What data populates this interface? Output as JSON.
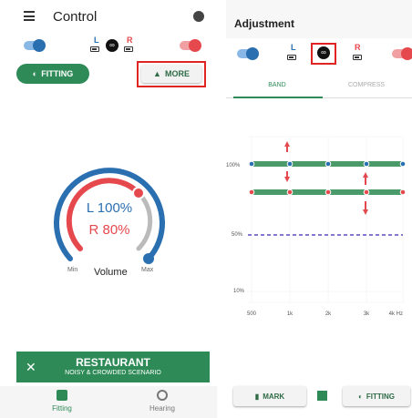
{
  "left": {
    "title": "Control",
    "left_label": "L",
    "right_label": "R",
    "fitting_label": "FITTING",
    "more_label": "MORE",
    "volume": {
      "left": "L 100%",
      "right": "R 80%",
      "label": "Volume",
      "min": "Min",
      "max": "Max",
      "left_level": 1.0,
      "right_level": 0.8
    },
    "scenario": {
      "title": "RESTAURANT",
      "subtitle": "NOISY & CROWDED SCENARIO"
    },
    "nav": [
      {
        "label": "Fitting",
        "icon": "fitting-icon"
      },
      {
        "label": "Hearing",
        "icon": "hearing-icon"
      }
    ]
  },
  "right": {
    "title": "Adjustment",
    "left_label": "L",
    "right_label": "R",
    "tabs": [
      "BAND",
      "COMPRESS"
    ],
    "chart_data": {
      "type": "line",
      "x": [
        "500",
        "1k",
        "2k",
        "3k",
        "4k Hz"
      ],
      "yticks": [
        "100%",
        "50%",
        "10%"
      ],
      "series": [
        {
          "color": "#2a6fb0",
          "level": 100
        },
        {
          "color": "#e5484d",
          "level": 90
        },
        {
          "color": "#5a4fc0",
          "level": 50,
          "style": "dashed"
        }
      ]
    },
    "mark_label": "MARK",
    "fitting_label": "FITTING"
  },
  "colors": {
    "green": "#2e8b57",
    "blue": "#2a6fb0",
    "red": "#e5484d",
    "highlight": "#e02424"
  }
}
